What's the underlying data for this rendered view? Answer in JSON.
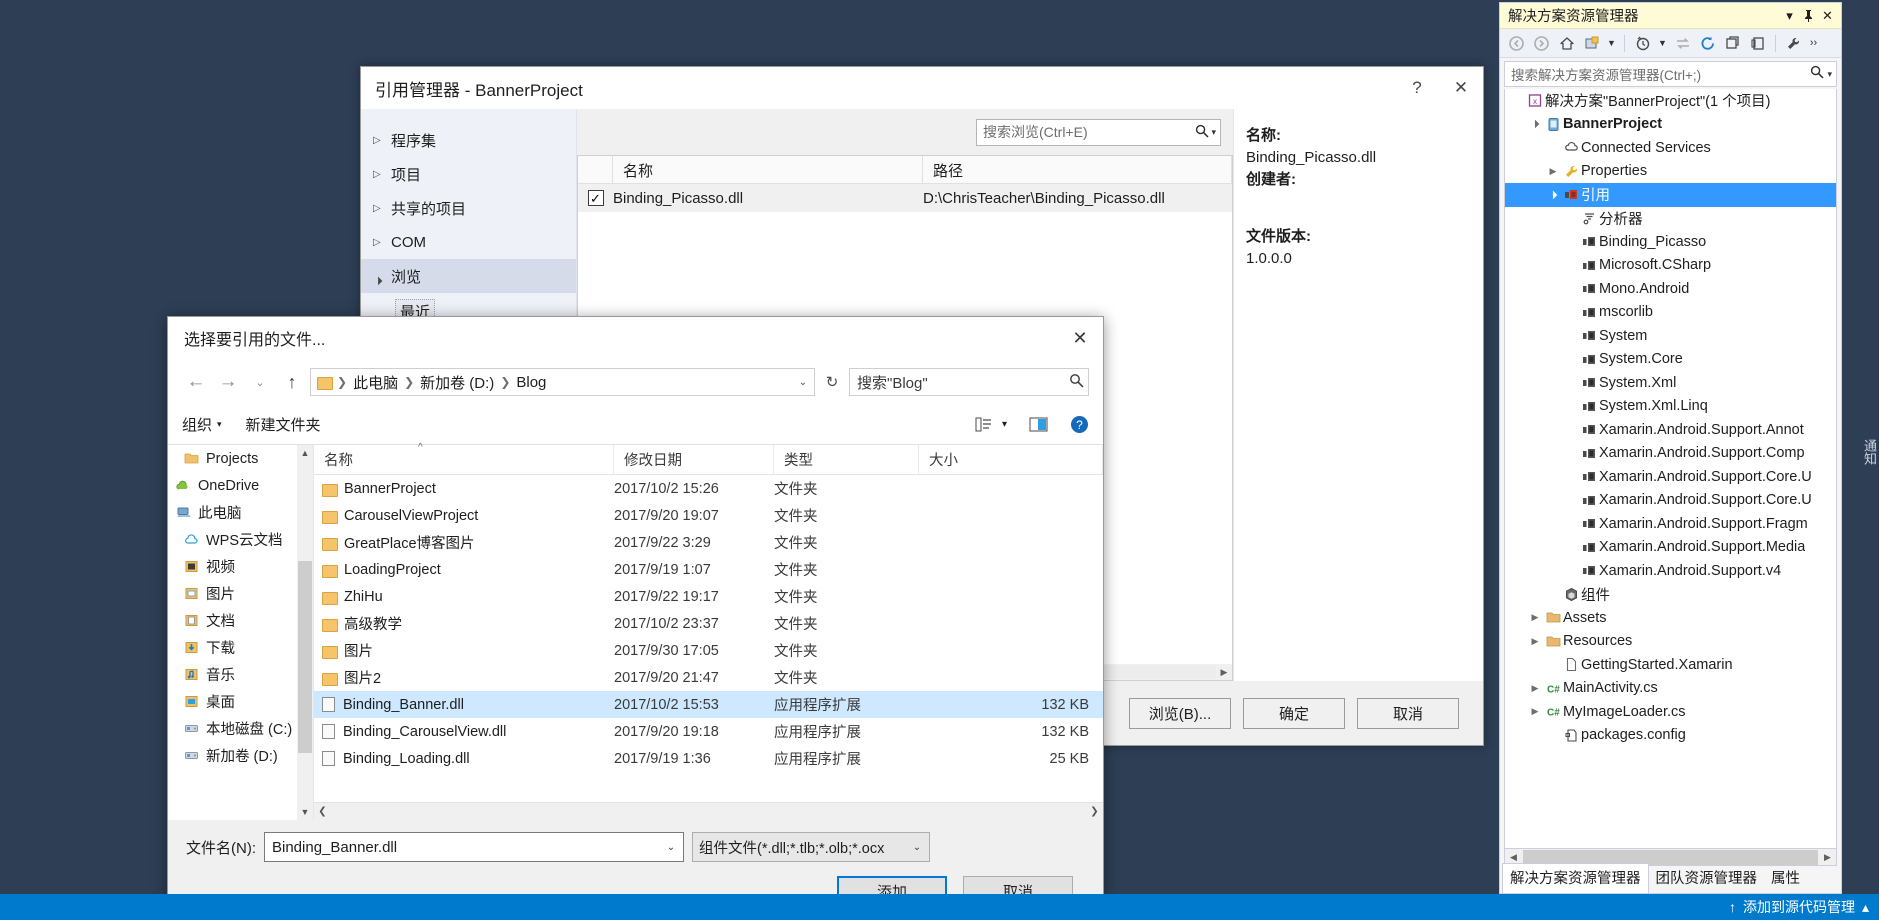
{
  "solution_explorer": {
    "title": "解决方案资源管理器",
    "titlebar_buttons": [
      {
        "name": "dropdown",
        "glyph": "▾"
      },
      {
        "name": "pin",
        "glyph": "⇱"
      },
      {
        "name": "close",
        "glyph": "✕"
      }
    ],
    "toolbar_icons": [
      "back-icon",
      "forward-icon",
      "home-icon",
      "collapse-all-icon",
      "dropdown-icon",
      "pending-changes-icon",
      "dropdown2-icon",
      "sync-icon",
      "refresh-icon",
      "show-all-files-icon",
      "properties-page-icon",
      "properties-icon",
      "overflow-icon"
    ],
    "search_placeholder": "搜索解决方案资源管理器(Ctrl+;)",
    "tree": [
      {
        "depth": 0,
        "arrow": "",
        "icon": "solution-icon",
        "label": "解决方案\"BannerProject\"(1 个项目)",
        "bold": false,
        "selected": false
      },
      {
        "depth": 1,
        "arrow": "▴",
        "icon": "project-icon",
        "label": "BannerProject",
        "bold": true,
        "selected": false
      },
      {
        "depth": 2,
        "arrow": "",
        "icon": "cloud-icon",
        "label": "Connected Services",
        "bold": false,
        "selected": false
      },
      {
        "depth": 2,
        "arrow": "▸",
        "icon": "wrench-icon",
        "label": "Properties",
        "bold": false,
        "selected": false
      },
      {
        "depth": 2,
        "arrow": "▴",
        "icon": "references-icon",
        "label": "引用",
        "bold": false,
        "selected": true
      },
      {
        "depth": 3,
        "arrow": "",
        "icon": "analyzer-icon",
        "label": "分析器",
        "bold": false,
        "selected": false
      },
      {
        "depth": 3,
        "arrow": "",
        "icon": "assembly-icon",
        "label": "Binding_Picasso",
        "bold": false,
        "selected": false
      },
      {
        "depth": 3,
        "arrow": "",
        "icon": "assembly-icon",
        "label": "Microsoft.CSharp",
        "bold": false,
        "selected": false
      },
      {
        "depth": 3,
        "arrow": "",
        "icon": "assembly-icon",
        "label": "Mono.Android",
        "bold": false,
        "selected": false
      },
      {
        "depth": 3,
        "arrow": "",
        "icon": "assembly-icon",
        "label": "mscorlib",
        "bold": false,
        "selected": false
      },
      {
        "depth": 3,
        "arrow": "",
        "icon": "assembly-icon",
        "label": "System",
        "bold": false,
        "selected": false
      },
      {
        "depth": 3,
        "arrow": "",
        "icon": "assembly-icon",
        "label": "System.Core",
        "bold": false,
        "selected": false
      },
      {
        "depth": 3,
        "arrow": "",
        "icon": "assembly-icon",
        "label": "System.Xml",
        "bold": false,
        "selected": false
      },
      {
        "depth": 3,
        "arrow": "",
        "icon": "assembly-icon",
        "label": "System.Xml.Linq",
        "bold": false,
        "selected": false
      },
      {
        "depth": 3,
        "arrow": "",
        "icon": "assembly-icon",
        "label": "Xamarin.Android.Support.Annot",
        "bold": false,
        "selected": false
      },
      {
        "depth": 3,
        "arrow": "",
        "icon": "assembly-icon",
        "label": "Xamarin.Android.Support.Comp",
        "bold": false,
        "selected": false
      },
      {
        "depth": 3,
        "arrow": "",
        "icon": "assembly-icon",
        "label": "Xamarin.Android.Support.Core.U",
        "bold": false,
        "selected": false
      },
      {
        "depth": 3,
        "arrow": "",
        "icon": "assembly-icon",
        "label": "Xamarin.Android.Support.Core.U",
        "bold": false,
        "selected": false
      },
      {
        "depth": 3,
        "arrow": "",
        "icon": "assembly-icon",
        "label": "Xamarin.Android.Support.Fragm",
        "bold": false,
        "selected": false
      },
      {
        "depth": 3,
        "arrow": "",
        "icon": "assembly-icon",
        "label": "Xamarin.Android.Support.Media",
        "bold": false,
        "selected": false
      },
      {
        "depth": 3,
        "arrow": "",
        "icon": "assembly-icon",
        "label": "Xamarin.Android.Support.v4",
        "bold": false,
        "selected": false
      },
      {
        "depth": 2,
        "arrow": "",
        "icon": "component-icon",
        "label": "组件",
        "bold": false,
        "selected": false
      },
      {
        "depth": 1,
        "arrow": "▸",
        "icon": "folder-icon",
        "label": "Assets",
        "bold": false,
        "selected": false
      },
      {
        "depth": 1,
        "arrow": "▸",
        "icon": "folder-icon",
        "label": "Resources",
        "bold": false,
        "selected": false
      },
      {
        "depth": 2,
        "arrow": "",
        "icon": "file-icon",
        "label": "GettingStarted.Xamarin",
        "bold": false,
        "selected": false
      },
      {
        "depth": 1,
        "arrow": "▸",
        "icon": "csharp-icon",
        "label": "MainActivity.cs",
        "bold": false,
        "selected": false
      },
      {
        "depth": 1,
        "arrow": "▸",
        "icon": "csharp-icon",
        "label": "MyImageLoader.cs",
        "bold": false,
        "selected": false
      },
      {
        "depth": 2,
        "arrow": "",
        "icon": "config-icon",
        "label": "packages.config",
        "bold": false,
        "selected": false
      }
    ],
    "tabs": [
      {
        "label": "解决方案资源管理器",
        "active": true
      },
      {
        "label": "团队资源管理器",
        "active": false
      },
      {
        "label": "属性",
        "active": false
      }
    ]
  },
  "status_bar": {
    "upload_icon": "↑",
    "text": "添加到源代码管理",
    "chevron": "▴"
  },
  "notification_strip": {
    "label": "通知"
  },
  "reference_manager": {
    "title": "引用管理器 - BannerProject",
    "help_glyph": "?",
    "close_glyph": "✕",
    "categories": [
      {
        "label": "程序集",
        "arrow": "▸",
        "active": false
      },
      {
        "label": "项目",
        "arrow": "▸",
        "active": false
      },
      {
        "label": "共享的项目",
        "arrow": "▸",
        "active": false
      },
      {
        "label": "COM",
        "arrow": "▸",
        "active": false
      },
      {
        "label": "浏览",
        "arrow": "▴",
        "active": true
      }
    ],
    "sub_item": "最近",
    "search_placeholder": "搜索浏览(Ctrl+E)",
    "search_icon": "search-icon",
    "columns": [
      "名称",
      "路径"
    ],
    "rows": [
      {
        "checked": true,
        "name": "Binding_Picasso.dll",
        "path": "D:\\ChrisTeacher\\Binding_Picasso.dll"
      }
    ],
    "details": {
      "name_key": "名称:",
      "name_value": "Binding_Picasso.dll",
      "author_key": "创建者:",
      "author_value": "",
      "version_key": "文件版本:",
      "version_value": "1.0.0.0"
    },
    "buttons": [
      {
        "label": "浏览(B)...",
        "name": "browse-button"
      },
      {
        "label": "确定",
        "name": "ok-button"
      },
      {
        "label": "取消",
        "name": "cancel-button"
      }
    ]
  },
  "file_dialog": {
    "title": "选择要引用的文件...",
    "close_glyph": "✕",
    "nav": {
      "back": "←",
      "forward": "→",
      "history": "⌄",
      "up": "↑",
      "refresh": "↻"
    },
    "breadcrumb": [
      "此电脑",
      "新加卷 (D:)",
      "Blog"
    ],
    "breadcrumb_chevron": "⌄",
    "search_placeholder": "搜索\"Blog\"",
    "toolbar": {
      "organize": "组织",
      "organize_caret": "▾",
      "new_folder": "新建文件夹",
      "view_icon": "view-list-icon",
      "view_caret": "▾",
      "preview_icon": "preview-pane-icon",
      "help_icon": "help-icon"
    },
    "nav_pane": [
      {
        "label": "Projects",
        "icon": "folder-icon",
        "indent": true
      },
      {
        "label": "OneDrive",
        "icon": "onedrive-icon",
        "indent": false
      },
      {
        "label": "此电脑",
        "icon": "this-pc-icon",
        "indent": false
      },
      {
        "label": "WPS云文档",
        "icon": "wps-cloud-icon",
        "indent": true
      },
      {
        "label": "视频",
        "icon": "videos-icon",
        "indent": true
      },
      {
        "label": "图片",
        "icon": "pictures-icon",
        "indent": true
      },
      {
        "label": "文档",
        "icon": "documents-icon",
        "indent": true
      },
      {
        "label": "下载",
        "icon": "downloads-icon",
        "indent": true
      },
      {
        "label": "音乐",
        "icon": "music-icon",
        "indent": true
      },
      {
        "label": "桌面",
        "icon": "desktop-icon",
        "indent": true
      },
      {
        "label": "本地磁盘 (C:)",
        "icon": "drive-icon",
        "indent": true
      },
      {
        "label": "新加卷 (D:)",
        "icon": "drive-icon",
        "indent": true
      }
    ],
    "columns": [
      "名称",
      "修改日期",
      "类型",
      "大小"
    ],
    "sort_indicator": "^",
    "files": [
      {
        "name": "BannerProject",
        "date": "2017/10/2 15:26",
        "type": "文件夹",
        "size": "",
        "icon": "folder-icon",
        "selected": false
      },
      {
        "name": "CarouselViewProject",
        "date": "2017/9/20 19:07",
        "type": "文件夹",
        "size": "",
        "icon": "folder-icon",
        "selected": false
      },
      {
        "name": "GreatPlace博客图片",
        "date": "2017/9/22 3:29",
        "type": "文件夹",
        "size": "",
        "icon": "folder-icon",
        "selected": false
      },
      {
        "name": "LoadingProject",
        "date": "2017/9/19 1:07",
        "type": "文件夹",
        "size": "",
        "icon": "folder-icon",
        "selected": false
      },
      {
        "name": "ZhiHu",
        "date": "2017/9/22 19:17",
        "type": "文件夹",
        "size": "",
        "icon": "folder-icon",
        "selected": false
      },
      {
        "name": "高级教学",
        "date": "2017/10/2 23:37",
        "type": "文件夹",
        "size": "",
        "icon": "folder-icon",
        "selected": false
      },
      {
        "name": "图片",
        "date": "2017/9/30 17:05",
        "type": "文件夹",
        "size": "",
        "icon": "folder-icon",
        "selected": false
      },
      {
        "name": "图片2",
        "date": "2017/9/20 21:47",
        "type": "文件夹",
        "size": "",
        "icon": "folder-icon",
        "selected": false
      },
      {
        "name": "Binding_Banner.dll",
        "date": "2017/10/2 15:53",
        "type": "应用程序扩展",
        "size": "132 KB",
        "icon": "dll-icon",
        "selected": true
      },
      {
        "name": "Binding_CarouselView.dll",
        "date": "2017/9/20 19:18",
        "type": "应用程序扩展",
        "size": "132 KB",
        "icon": "dll-icon",
        "selected": false
      },
      {
        "name": "Binding_Loading.dll",
        "date": "2017/9/19 1:36",
        "type": "应用程序扩展",
        "size": "25 KB",
        "icon": "dll-icon",
        "selected": false
      }
    ],
    "filename_label": "文件名(N):",
    "filename_value": "Binding_Banner.dll",
    "filter_value": "组件文件(*.dll;*.tlb;*.olb;*.ocx",
    "buttons": [
      {
        "label": "添加",
        "name": "add-button",
        "primary": true
      },
      {
        "label": "取消",
        "name": "cancel-button",
        "primary": false
      }
    ]
  }
}
